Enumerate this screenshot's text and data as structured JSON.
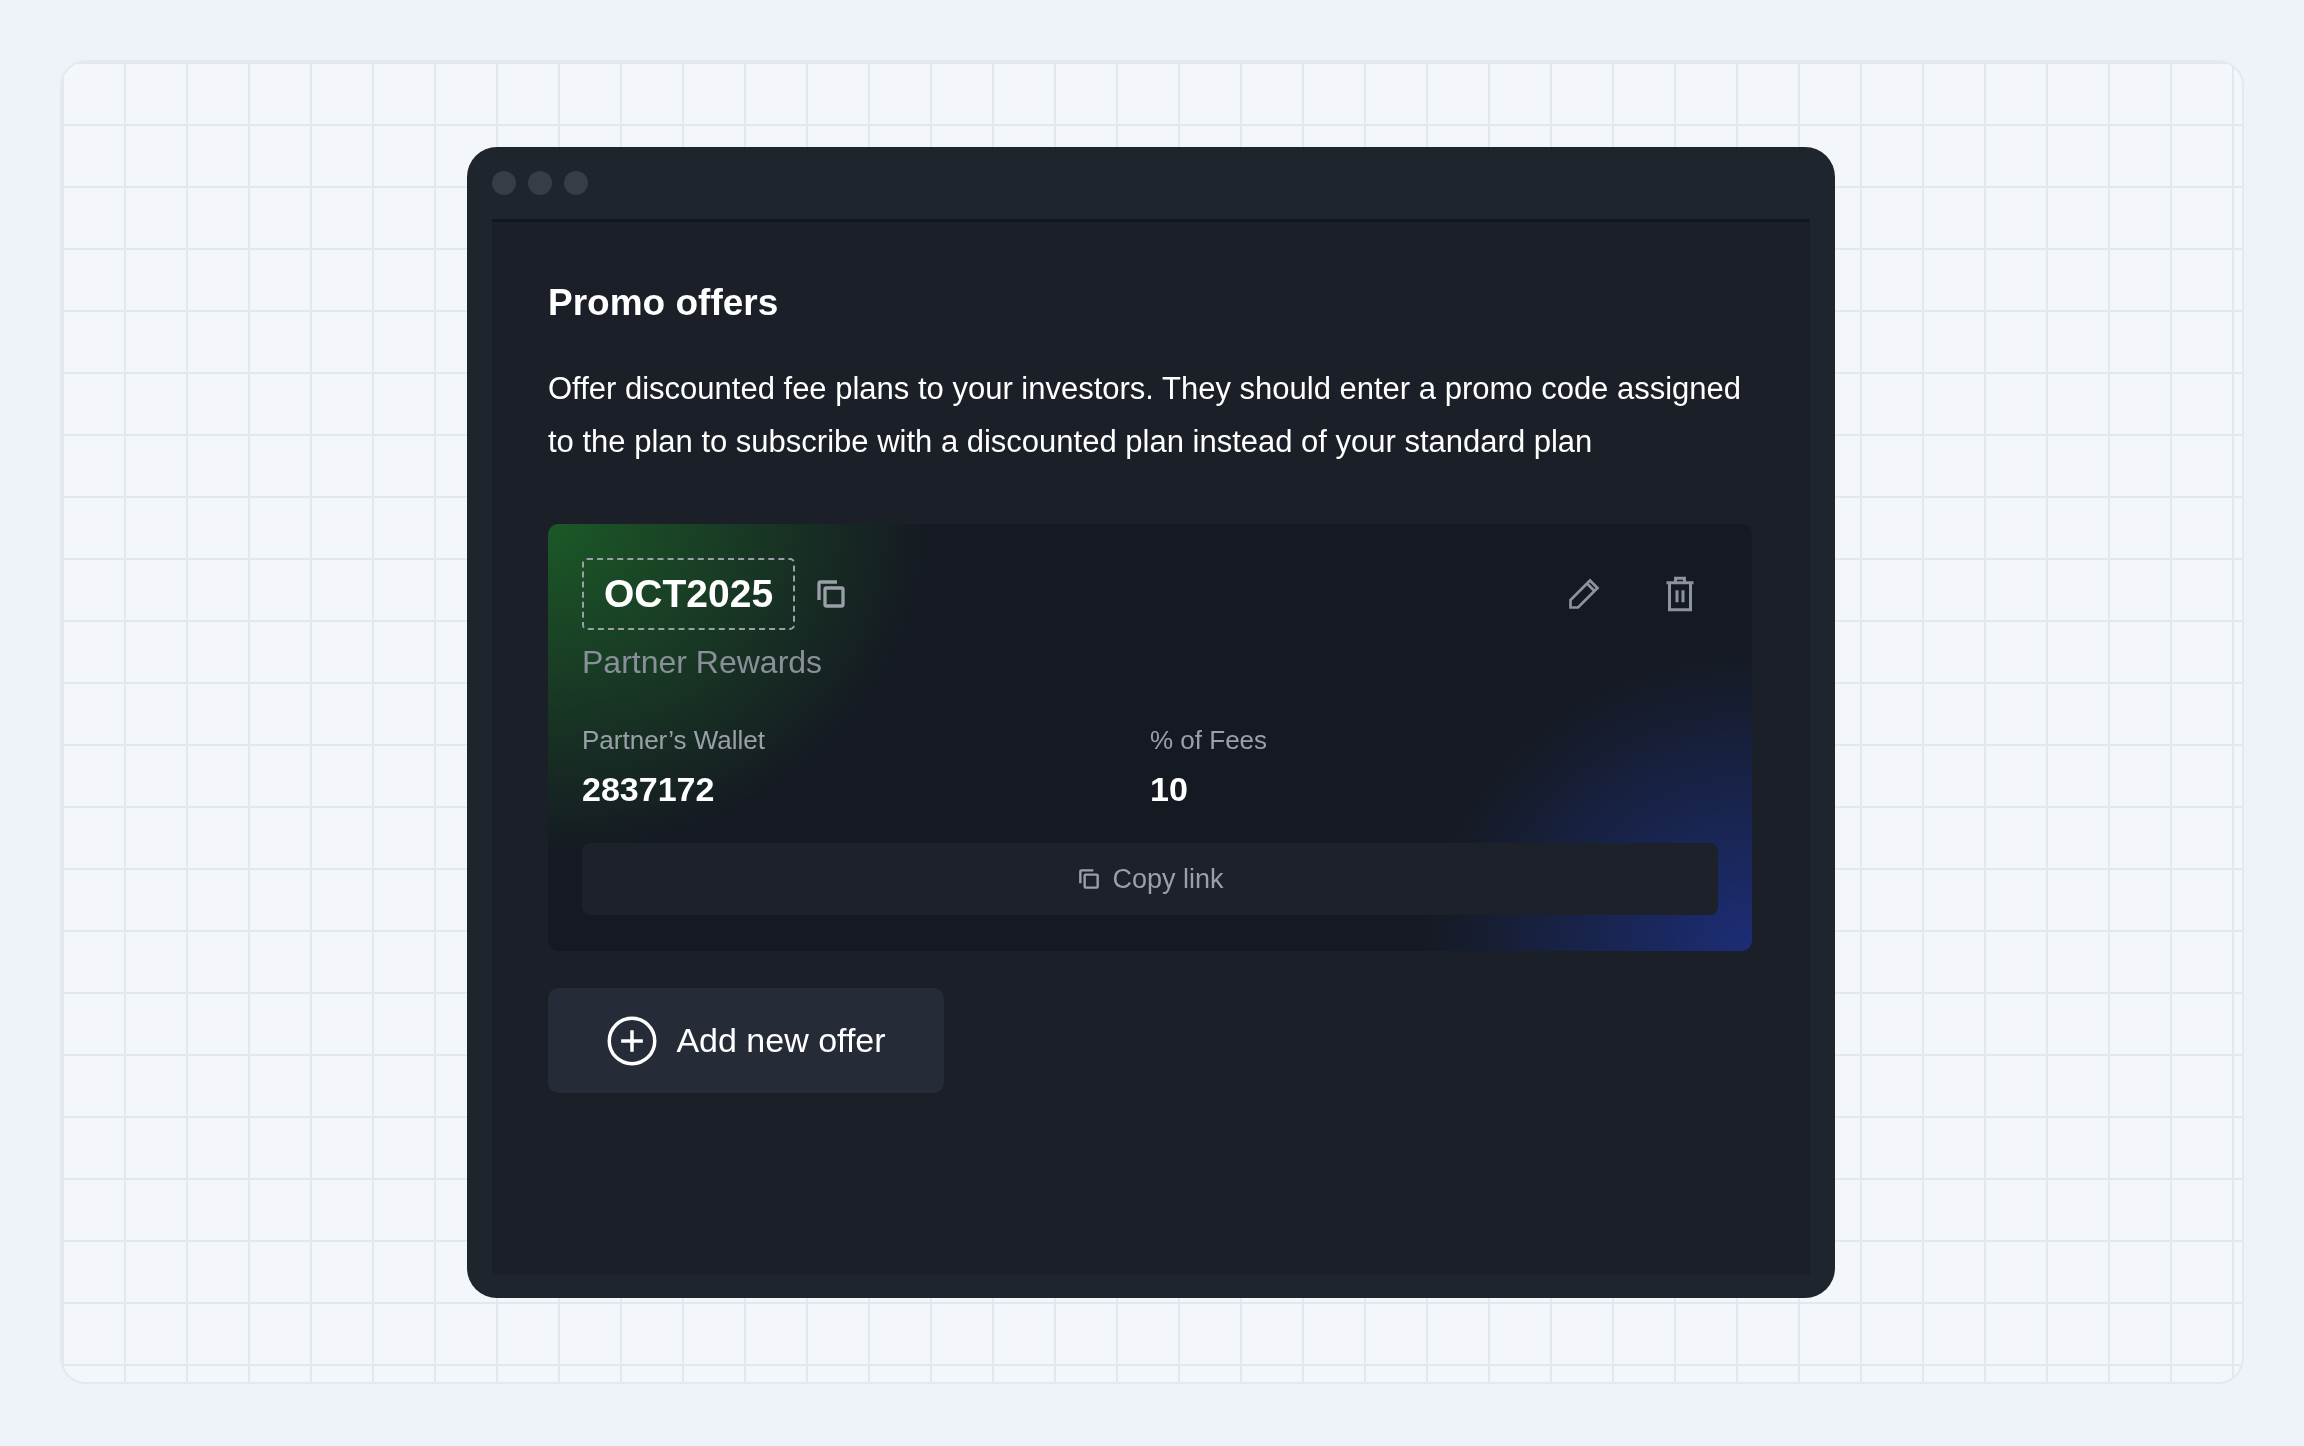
{
  "title": "Promo offers",
  "description": "Offer discounted fee plans to your investors. They should enter a promo code assigned to the plan to subscribe with a discounted plan instead of your standard plan",
  "offers": [
    {
      "code": "OCT2025",
      "name": "Partner Rewards",
      "fields": [
        {
          "label": "Partner’s Wallet",
          "value": "2837172"
        },
        {
          "label": "% of Fees",
          "value": "10"
        }
      ],
      "copy_link": "Copy link"
    }
  ],
  "add_button": "Add new offer"
}
